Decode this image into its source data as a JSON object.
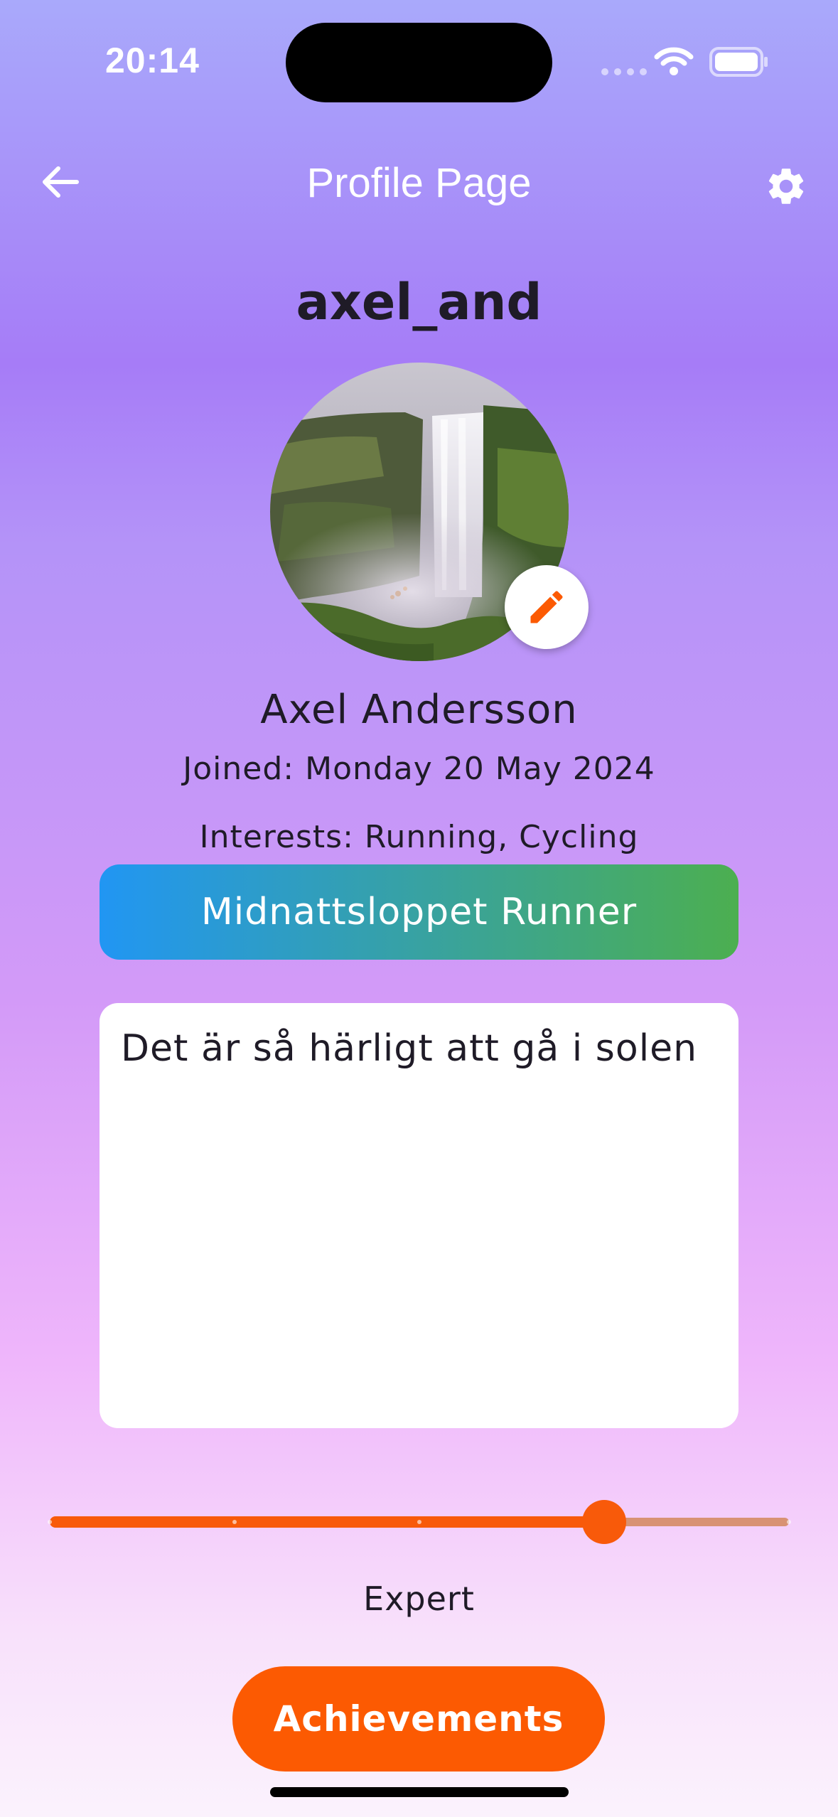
{
  "status_bar": {
    "time": "20:14"
  },
  "nav": {
    "title": "Profile Page",
    "back_icon": "arrow-left-icon",
    "settings_icon": "gear-icon"
  },
  "profile": {
    "username": "axel_and",
    "full_name": "Axel Andersson",
    "joined": "Joined: Monday 20 May 2024",
    "interests": "Interests: Running, Cycling",
    "badge": "Midnattsloppet Runner",
    "bio": "Det är så härligt att gå i solen",
    "edit_icon": "pencil-icon"
  },
  "level_slider": {
    "value_fraction": 0.75,
    "divisions": 4,
    "label": "Expert"
  },
  "actions": {
    "achievements_label": "Achievements"
  },
  "colors": {
    "accent": "#fc5a02",
    "badge_start": "#2196f3",
    "badge_end": "#4caf50"
  }
}
